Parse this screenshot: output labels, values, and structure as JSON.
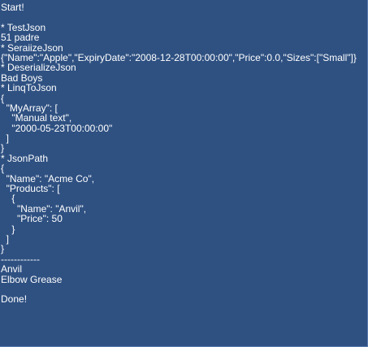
{
  "console": {
    "lines": [
      "Start!",
      "",
      "* TestJson",
      "51 padre",
      "* SeraiizeJson",
      "{\"Name\":\"Apple\",\"ExpiryDate\":\"2008-12-28T00:00:00\",\"Price\":0.0,\"Sizes\":[\"Small\"]}",
      "* DeserializeJson",
      "Bad Boys",
      "* LinqToJson",
      "{",
      "  \"MyArray\": [",
      "    \"Manual text\",",
      "    \"2000-05-23T00:00:00\"",
      "  ]",
      "}",
      "* JsonPath",
      "{",
      "  \"Name\": \"Acme Co\",",
      "  \"Products\": [",
      "    {",
      "      \"Name\": \"Anvil\",",
      "      \"Price\": 50",
      "    }",
      "  ]",
      "}",
      "------------",
      "Anvil",
      "Elbow Grease",
      "",
      "Done!"
    ]
  }
}
